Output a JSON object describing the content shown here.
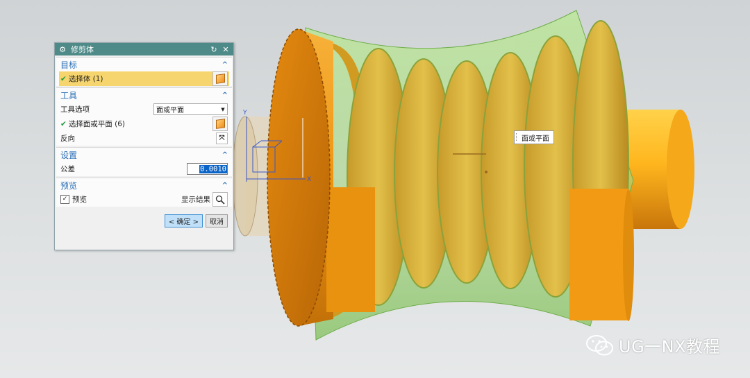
{
  "dialog": {
    "title": "修剪体",
    "gear_icon": "gear-icon",
    "reset_icon": "reset-icon",
    "close_icon": "close-icon",
    "target": {
      "header": "目标",
      "select_body": "选择体 (1)"
    },
    "tool": {
      "header": "工具",
      "tool_option_label": "工具选项",
      "tool_option_value": "面或平面",
      "select_face": "选择面或平面 (6)",
      "reverse_label": "反向"
    },
    "settings": {
      "header": "设置",
      "tolerance_label": "公差",
      "tolerance_value": "0.0010"
    },
    "preview": {
      "header": "预览",
      "preview_label": "预览",
      "preview_checked": true,
      "show_result_label": "显示结果"
    },
    "ok_label": "< 确定 >",
    "cancel_label": "取消"
  },
  "tooltip": {
    "text": "面或平面"
  },
  "triad": {
    "y_label": "Y",
    "x_label": "X"
  },
  "watermark": {
    "text": "UG一NX教程"
  },
  "colors": {
    "title_bar": "#4e8a88",
    "header_text": "#2a6fb6",
    "selected_row": "#f7d56e",
    "body_orange": "#f29a14",
    "trim_green": "#9ed67a"
  }
}
